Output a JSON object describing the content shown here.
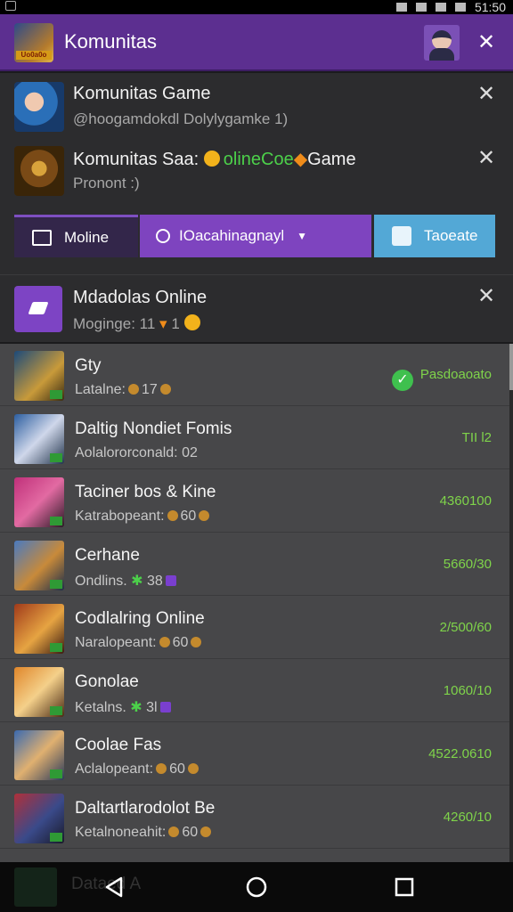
{
  "status_bar": {
    "time": "51:50"
  },
  "header": {
    "title": "Komunitas",
    "app_icon_caption": "Uo0a0o"
  },
  "notifications": [
    {
      "title": "Komunitas Game",
      "subtitle": "@hoogamdokdl  Dolylygamke 1)"
    },
    {
      "title_prefix": "Komunitas Saa:",
      "title_green": "olineCoe",
      "title_orange": "Game",
      "subtitle": "Pronont :)"
    }
  ],
  "tabs": [
    {
      "label": "Moline"
    },
    {
      "label": "IOacahinagnayl"
    },
    {
      "label": "Taoeate"
    }
  ],
  "notification3": {
    "title": "Mdadolas Online",
    "subtitle": "Moginge: 11",
    "badge": "1"
  },
  "games": [
    {
      "name": "Gty",
      "sub": "Latalne:",
      "count": "17",
      "value": "Pasdoaoato",
      "checked": true
    },
    {
      "name": "Daltig Nondiet Fomis",
      "sub": "Aolalororconald:",
      "count": "02",
      "value": "TII l2",
      "checked": false
    },
    {
      "name": "Taciner bos & Kine",
      "sub": "Katrabopeant:",
      "count": "60",
      "value": "4360100",
      "checked": false
    },
    {
      "name": "Cerhane",
      "sub": "Ondlins.",
      "count": "38",
      "value": "5660/30",
      "checked": false
    },
    {
      "name": "Codlalring Online",
      "sub": "Naralopeant:",
      "count": "60",
      "value": "2/500/60",
      "checked": false
    },
    {
      "name": "Gonolae",
      "sub": "Ketalns.",
      "count": "3l",
      "value": "1060/10",
      "checked": false
    },
    {
      "name": "Coolae Fas",
      "sub": "Aclalopeant:",
      "count": "60",
      "value": "4522.0610",
      "checked": false
    },
    {
      "name": "Daltartlarodolot Be",
      "sub": "Ketalnoneahit:",
      "count": "60",
      "value": "4260/10",
      "checked": false
    }
  ],
  "bottom_peek": {
    "label": "Dataed A"
  },
  "icons": {
    "close": "close-icon",
    "message": "message-icon",
    "people": "people-icon",
    "chevron": "chevron-down-icon",
    "calendar": "calendar-icon",
    "edit": "edit-icon",
    "check": "check-icon",
    "back": "back-icon",
    "home": "home-icon",
    "recent": "recent-apps-icon"
  },
  "colors": {
    "brand": "#5c2f90",
    "accent_tab": "#7e44bf",
    "blue_tab": "#53a8d6",
    "value_green": "#7fd44a"
  }
}
